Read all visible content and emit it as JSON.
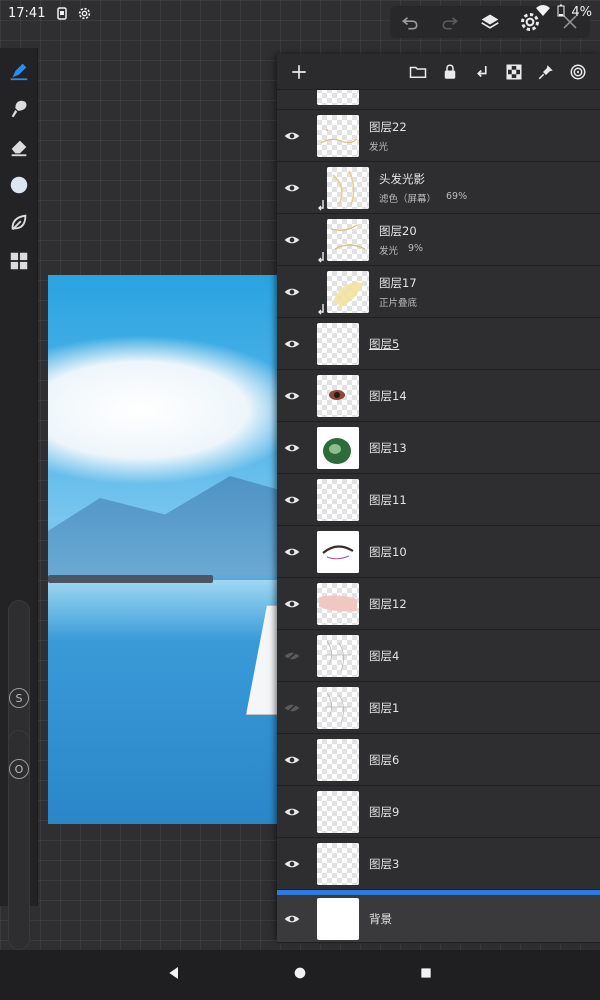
{
  "status_bar": {
    "time": "17:41",
    "battery": "4%"
  },
  "layers": [
    {
      "name": "图层22",
      "mode": "发光",
      "opacity": "",
      "clipped": false,
      "visible": true,
      "thumb": "sparkle"
    },
    {
      "name": "头发光影",
      "mode": "滤色（屏幕）",
      "opacity": "69%",
      "clipped": true,
      "visible": true,
      "thumb": "hair"
    },
    {
      "name": "图层20",
      "mode": "发光",
      "opacity": "9%",
      "clipped": true,
      "visible": true,
      "thumb": "hair2"
    },
    {
      "name": "图层17",
      "mode": "正片叠底",
      "opacity": "",
      "clipped": true,
      "visible": true,
      "thumb": "yellow"
    },
    {
      "name": "图层5",
      "mode": "",
      "opacity": "",
      "clipped": false,
      "visible": true,
      "thumb": "blank",
      "underline": true
    },
    {
      "name": "图层14",
      "mode": "",
      "opacity": "",
      "clipped": false,
      "visible": true,
      "thumb": "eye"
    },
    {
      "name": "图层13",
      "mode": "",
      "opacity": "",
      "clipped": false,
      "visible": true,
      "thumb": "green"
    },
    {
      "name": "图层11",
      "mode": "",
      "opacity": "",
      "clipped": false,
      "visible": true,
      "thumb": "blank"
    },
    {
      "name": "图层10",
      "mode": "",
      "opacity": "",
      "clipped": false,
      "visible": true,
      "thumb": "eyeline"
    },
    {
      "name": "图层12",
      "mode": "",
      "opacity": "",
      "clipped": false,
      "visible": true,
      "thumb": "pink"
    },
    {
      "name": "图层4",
      "mode": "",
      "opacity": "",
      "clipped": false,
      "visible": false,
      "thumb": "sketch"
    },
    {
      "name": "图层1",
      "mode": "",
      "opacity": "",
      "clipped": false,
      "visible": false,
      "thumb": "sketch"
    },
    {
      "name": "图层6",
      "mode": "",
      "opacity": "",
      "clipped": false,
      "visible": true,
      "thumb": "blank"
    },
    {
      "name": "图层9",
      "mode": "",
      "opacity": "",
      "clipped": false,
      "visible": true,
      "thumb": "blank"
    },
    {
      "name": "图层3",
      "mode": "",
      "opacity": "",
      "clipped": false,
      "visible": true,
      "thumb": "blank"
    }
  ],
  "background_layer": {
    "name": "背景",
    "visible": true
  },
  "slider_labels": {
    "size": "S",
    "opacity": "O"
  },
  "colors": {
    "accent": "#2d7be0",
    "panel": "#2b2b2d",
    "toolbar": "#232325"
  },
  "icons": {
    "top_actions": [
      "undo-icon",
      "redo-icon",
      "layers-icon",
      "settings-icon",
      "close-icon"
    ],
    "panel_toolbar": [
      "add-layer-icon",
      "folder-icon",
      "lock-icon",
      "clip-icon",
      "transparency-icon",
      "pin-icon",
      "spiral-icon"
    ],
    "tools": [
      "pen-icon",
      "brush-icon",
      "eraser-icon",
      "color-icon",
      "leaf-icon",
      "grid-icon"
    ]
  }
}
